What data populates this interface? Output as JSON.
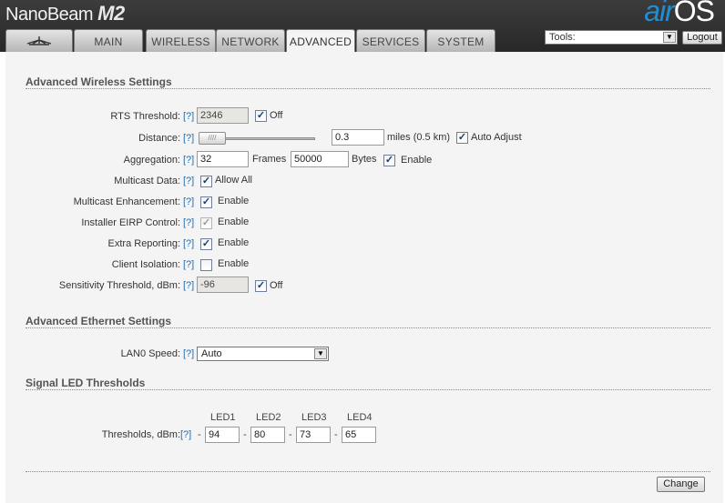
{
  "header": {
    "brand": "NanoBeam",
    "model": "M2",
    "logo_air": "air",
    "logo_os": "OS"
  },
  "tabs": [
    {
      "label": "",
      "icon": "ubiquiti-logo-icon"
    },
    {
      "label": "MAIN"
    },
    {
      "label": "WIRELESS"
    },
    {
      "label": "NETWORK"
    },
    {
      "label": "ADVANCED",
      "active": true
    },
    {
      "label": "SERVICES"
    },
    {
      "label": "SYSTEM"
    }
  ],
  "tools": {
    "selected": "Tools:"
  },
  "logout_label": "Logout",
  "help_label": "[?]",
  "sections": {
    "wireless": {
      "title": "Advanced Wireless Settings",
      "rts": {
        "label": "RTS Threshold:",
        "value": "2346",
        "check_label": "Off",
        "checked": true
      },
      "distance": {
        "label": "Distance:",
        "value": "0.3",
        "unit": "miles (0.5 km)",
        "auto_label": "Auto Adjust",
        "auto_checked": true
      },
      "aggregation": {
        "label": "Aggregation:",
        "frames": "32",
        "frames_label": "Frames",
        "bytes": "50000",
        "bytes_label": "Bytes",
        "enable_label": "Enable",
        "checked": true
      },
      "multicast_data": {
        "label": "Multicast Data:",
        "check_label": "Allow All",
        "checked": true
      },
      "multicast_enh": {
        "label": "Multicast Enhancement:",
        "check_label": "Enable",
        "checked": true
      },
      "installer_eirp": {
        "label": "Installer EIRP Control:",
        "check_label": "Enable",
        "checked": true,
        "disabled": true
      },
      "extra_reporting": {
        "label": "Extra Reporting:",
        "check_label": "Enable",
        "checked": true
      },
      "client_isolation": {
        "label": "Client Isolation:",
        "check_label": "Enable",
        "checked": false
      },
      "sensitivity": {
        "label": "Sensitivity Threshold, dBm:",
        "value": "-96",
        "check_label": "Off",
        "checked": true
      }
    },
    "ethernet": {
      "title": "Advanced Ethernet Settings",
      "lan0": {
        "label": "LAN0 Speed:",
        "selected": "Auto"
      }
    },
    "led": {
      "title": "Signal LED Thresholds",
      "label": "Thresholds, dBm:",
      "headers": [
        "LED1",
        "LED2",
        "LED3",
        "LED4"
      ],
      "values": [
        "94",
        "80",
        "73",
        "65"
      ],
      "prefix": "-"
    }
  },
  "change_label": "Change",
  "colors": {
    "header_bg": "#2e2e2e",
    "accent": "#1e8fd6",
    "content_bg": "#f4f4f4"
  }
}
